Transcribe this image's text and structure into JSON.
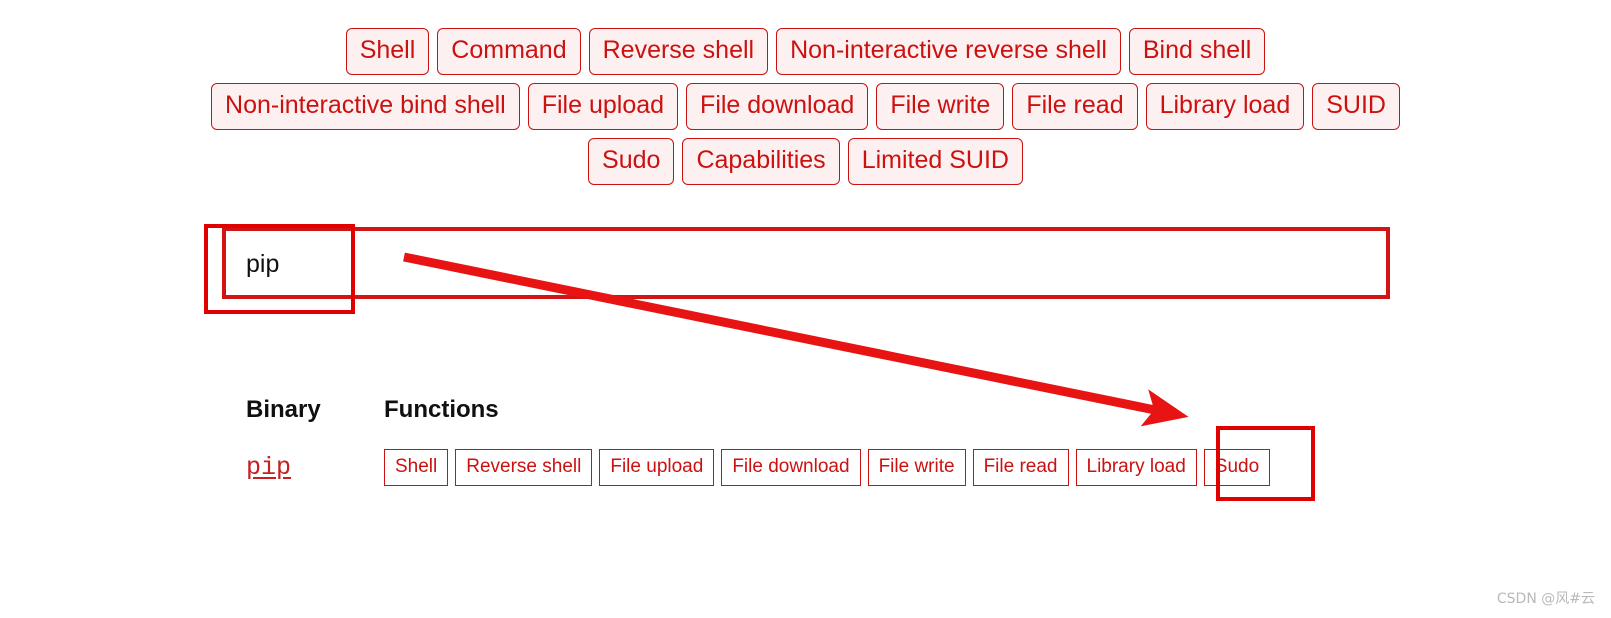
{
  "filters": {
    "rows": [
      [
        "Shell",
        "Command",
        "Reverse shell",
        "Non-interactive reverse shell",
        "Bind shell"
      ],
      [
        "Non-interactive bind shell",
        "File upload",
        "File download",
        "File write",
        "File read",
        "Library load",
        "SUID"
      ],
      [
        "Sudo",
        "Capabilities",
        "Limited SUID"
      ]
    ]
  },
  "search": {
    "value": "pip",
    "placeholder": ""
  },
  "results": {
    "headers": {
      "binary": "Binary",
      "functions": "Functions"
    },
    "rows": [
      {
        "binary": "pip",
        "functions": [
          "Shell",
          "Reverse shell",
          "File upload",
          "File download",
          "File write",
          "File read",
          "Library load",
          "Sudo"
        ]
      }
    ]
  },
  "annotations": {
    "highlight_color": "#e00000",
    "arrow_color": "#e81414",
    "arrow_from": "search box",
    "arrow_to": "Sudo function tag"
  },
  "watermark": {
    "text": "CSDN @风#云"
  }
}
